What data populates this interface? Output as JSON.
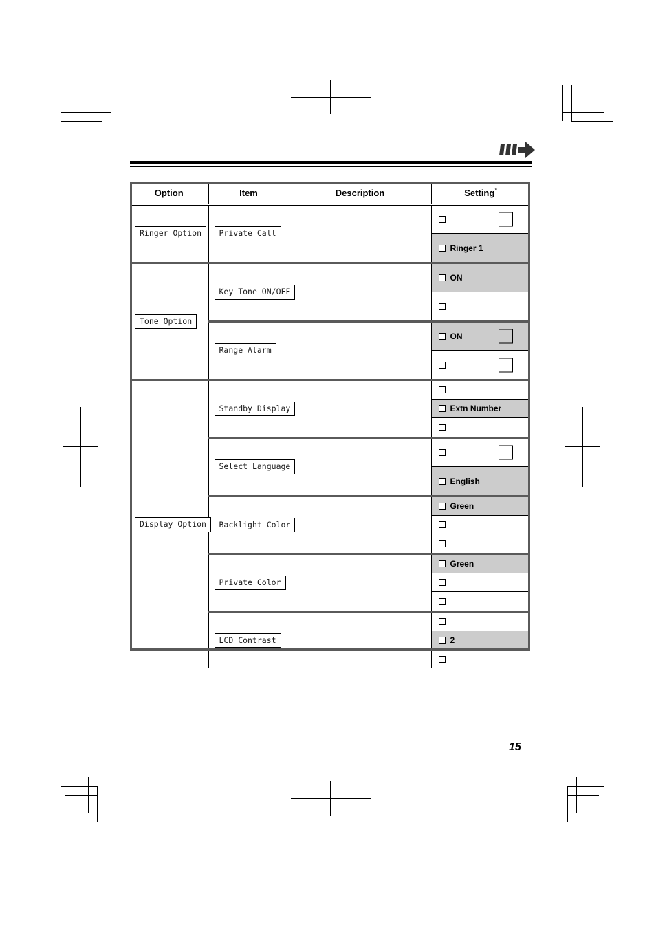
{
  "page": {
    "number": "15",
    "header_icon": "triple-bar-right-arrow-icon"
  },
  "table": {
    "columns": [
      {
        "label": "Option"
      },
      {
        "label": "Item"
      },
      {
        "label": "Description"
      },
      {
        "label": "Setting",
        "footnote_marker": "*"
      }
    ],
    "groups": [
      {
        "option": "Ringer Option",
        "items": [
          {
            "item": "Private Call",
            "description": "",
            "settings": [
              {
                "label": "",
                "shaded": false,
                "big_box": true
              },
              {
                "label": "Ringer 1",
                "shaded": true,
                "big_box": false
              }
            ]
          }
        ]
      },
      {
        "option": "Tone Option",
        "items": [
          {
            "item": "Key Tone ON/OFF",
            "description": "",
            "settings": [
              {
                "label": "ON",
                "shaded": true,
                "big_box": false
              },
              {
                "label": "",
                "shaded": false,
                "big_box": false
              }
            ]
          },
          {
            "item": "Range Alarm",
            "description": "",
            "settings": [
              {
                "label": "ON",
                "shaded": true,
                "big_box": true
              },
              {
                "label": "",
                "shaded": false,
                "big_box": true
              }
            ]
          }
        ]
      },
      {
        "option": "Display Option",
        "items": [
          {
            "item": "Standby Display",
            "description": "",
            "settings": [
              {
                "label": "",
                "shaded": false,
                "big_box": false
              },
              {
                "label": "Extn Number",
                "shaded": true,
                "big_box": false
              },
              {
                "label": "",
                "shaded": false,
                "big_box": false
              }
            ]
          },
          {
            "item": "Select Language",
            "description": "",
            "settings": [
              {
                "label": "",
                "shaded": false,
                "big_box": true
              },
              {
                "label": "English",
                "shaded": true,
                "big_box": false
              }
            ]
          },
          {
            "item": "Backlight Color",
            "description": "",
            "settings": [
              {
                "label": "Green",
                "shaded": true,
                "big_box": false
              },
              {
                "label": "",
                "shaded": false,
                "big_box": false
              },
              {
                "label": "",
                "shaded": false,
                "big_box": false
              }
            ]
          },
          {
            "item": "Private Color",
            "description": "",
            "settings": [
              {
                "label": "Green",
                "shaded": true,
                "big_box": false
              },
              {
                "label": "",
                "shaded": false,
                "big_box": false
              },
              {
                "label": "",
                "shaded": false,
                "big_box": false
              }
            ]
          },
          {
            "item": "LCD Contrast",
            "description": "",
            "settings": [
              {
                "label": "",
                "shaded": false,
                "big_box": false
              },
              {
                "label": "2",
                "shaded": true,
                "big_box": false
              },
              {
                "label": "",
                "shaded": false,
                "big_box": false
              }
            ]
          }
        ]
      }
    ]
  },
  "colors": {
    "shaded_row": "#cccccc",
    "rule_grey": "#5a5a5a",
    "ink": "#000000"
  }
}
